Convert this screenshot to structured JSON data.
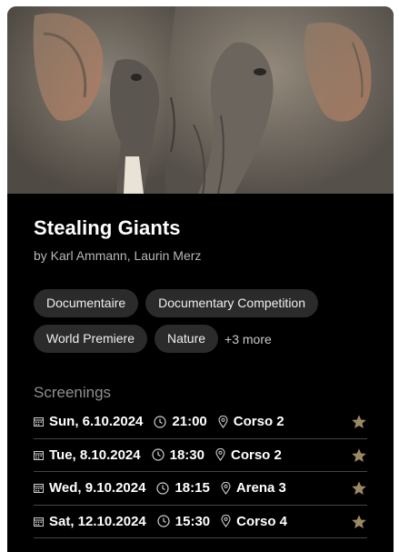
{
  "film": {
    "title": "Stealing Giants",
    "byline": "by Karl Ammann, Laurin Merz"
  },
  "tags": {
    "row1": [
      "Documentaire",
      "Documentary Competition"
    ],
    "row2": [
      "World Premiere",
      "Nature"
    ],
    "more": "+3 more"
  },
  "screenings": {
    "heading": "Screenings",
    "items": [
      {
        "date": "Sun, 6.10.2024",
        "time": "21:00",
        "venue": "Corso 2"
      },
      {
        "date": "Tue, 8.10.2024",
        "time": "18:30",
        "venue": "Corso 2"
      },
      {
        "date": "Wed, 9.10.2024",
        "time": "18:15",
        "venue": "Arena 3"
      },
      {
        "date": "Sat, 12.10.2024",
        "time": "15:30",
        "venue": "Corso 4"
      }
    ]
  },
  "icons": {
    "date": "calendar-icon",
    "time": "clock-icon",
    "venue": "location-pin-icon",
    "favorite": "star-icon"
  },
  "colors": {
    "card_background": "#000000",
    "tag_background": "#2b2b2b",
    "star": "#9a8a63"
  }
}
